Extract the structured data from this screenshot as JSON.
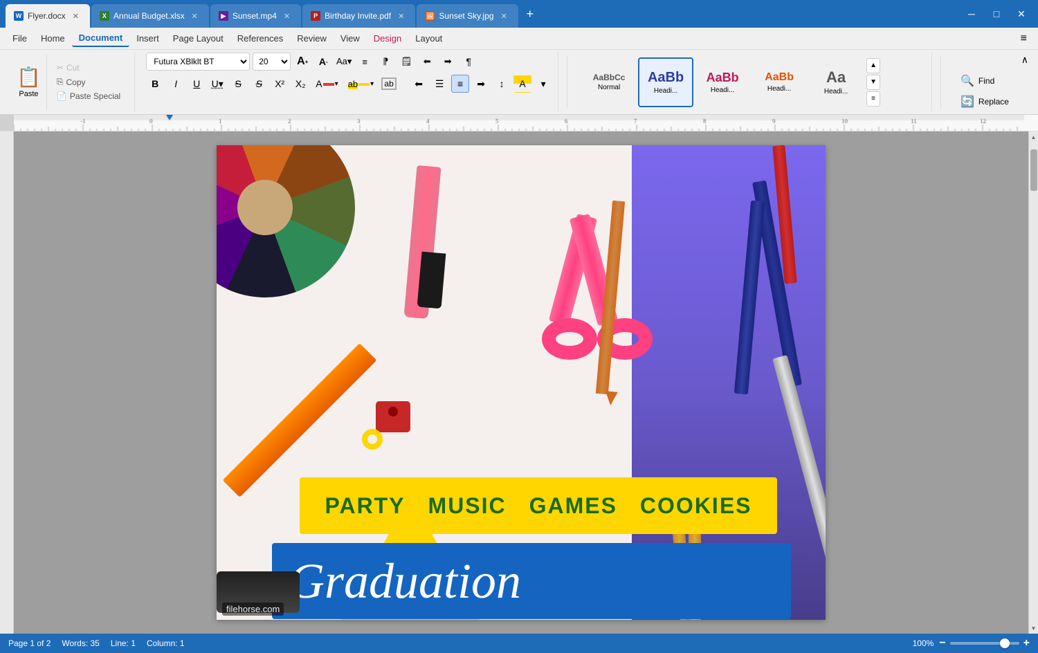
{
  "titlebar": {
    "tabs": [
      {
        "id": "flyer",
        "label": "Flyer.docx",
        "icon_color": "#1565c0",
        "icon_char": "W",
        "active": true
      },
      {
        "id": "budget",
        "label": "Annual Budget.xlsx",
        "icon_color": "#2e7d32",
        "icon_char": "X",
        "active": false
      },
      {
        "id": "sunset",
        "label": "Sunset.mp4",
        "icon_color": "#6a1b9a",
        "icon_char": "▶",
        "active": false
      },
      {
        "id": "birthday",
        "label": "Birthday Invite.pdf",
        "icon_color": "#b71c1c",
        "icon_char": "P",
        "active": false
      },
      {
        "id": "sky",
        "label": "Sunset Sky.jpg",
        "icon_color": "#e65100",
        "icon_char": "🖼",
        "active": false
      }
    ],
    "controls": {
      "minimize": "─",
      "maximize": "□",
      "close": "✕"
    }
  },
  "menubar": {
    "items": [
      {
        "label": "File",
        "active": false
      },
      {
        "label": "Home",
        "active": false
      },
      {
        "label": "Document",
        "active": true
      },
      {
        "label": "Insert",
        "active": false
      },
      {
        "label": "Page Layout",
        "active": false
      },
      {
        "label": "References",
        "active": false
      },
      {
        "label": "Review",
        "active": false
      },
      {
        "label": "View",
        "active": false
      },
      {
        "label": "Design",
        "active": false,
        "special": "design"
      },
      {
        "label": "Layout",
        "active": false,
        "special": "layout"
      }
    ]
  },
  "ribbon": {
    "clipboard": {
      "paste_label": "Paste",
      "cut_label": "Cut",
      "copy_label": "Copy",
      "paste_special_label": "Paste Special"
    },
    "font": {
      "family": "Futura XBlklt BT",
      "size": "20",
      "size_increase": "A",
      "size_decrease": "A"
    },
    "styles": {
      "items": [
        {
          "label": "Normal",
          "preview": "AaBbCc",
          "class": "normal-style",
          "active": false
        },
        {
          "label": "Headi...",
          "preview": "AaBb",
          "class": "h1-style",
          "active": true
        },
        {
          "label": "Headi...",
          "preview": "AaBb",
          "class": "h2-style",
          "active": false
        },
        {
          "label": "Headi...",
          "preview": "AaBb",
          "class": "h3-style",
          "active": false
        },
        {
          "label": "Headi...",
          "preview": "Aa",
          "class": "h3-style",
          "active": false
        }
      ]
    },
    "find_replace": {
      "find_label": "Find",
      "replace_label": "Replace"
    }
  },
  "document": {
    "banner_items": [
      "PARTY",
      "MUSIC",
      "GAMES",
      "COOKIES"
    ],
    "grad_text": "Graduation",
    "watermark": "filehorse.com"
  },
  "statusbar": {
    "page_info": "Page 1 of 2",
    "words": "Words: 35",
    "line": "Line: 1",
    "column": "Column: 1",
    "zoom_percent": "100%",
    "zoom_value": 100
  }
}
